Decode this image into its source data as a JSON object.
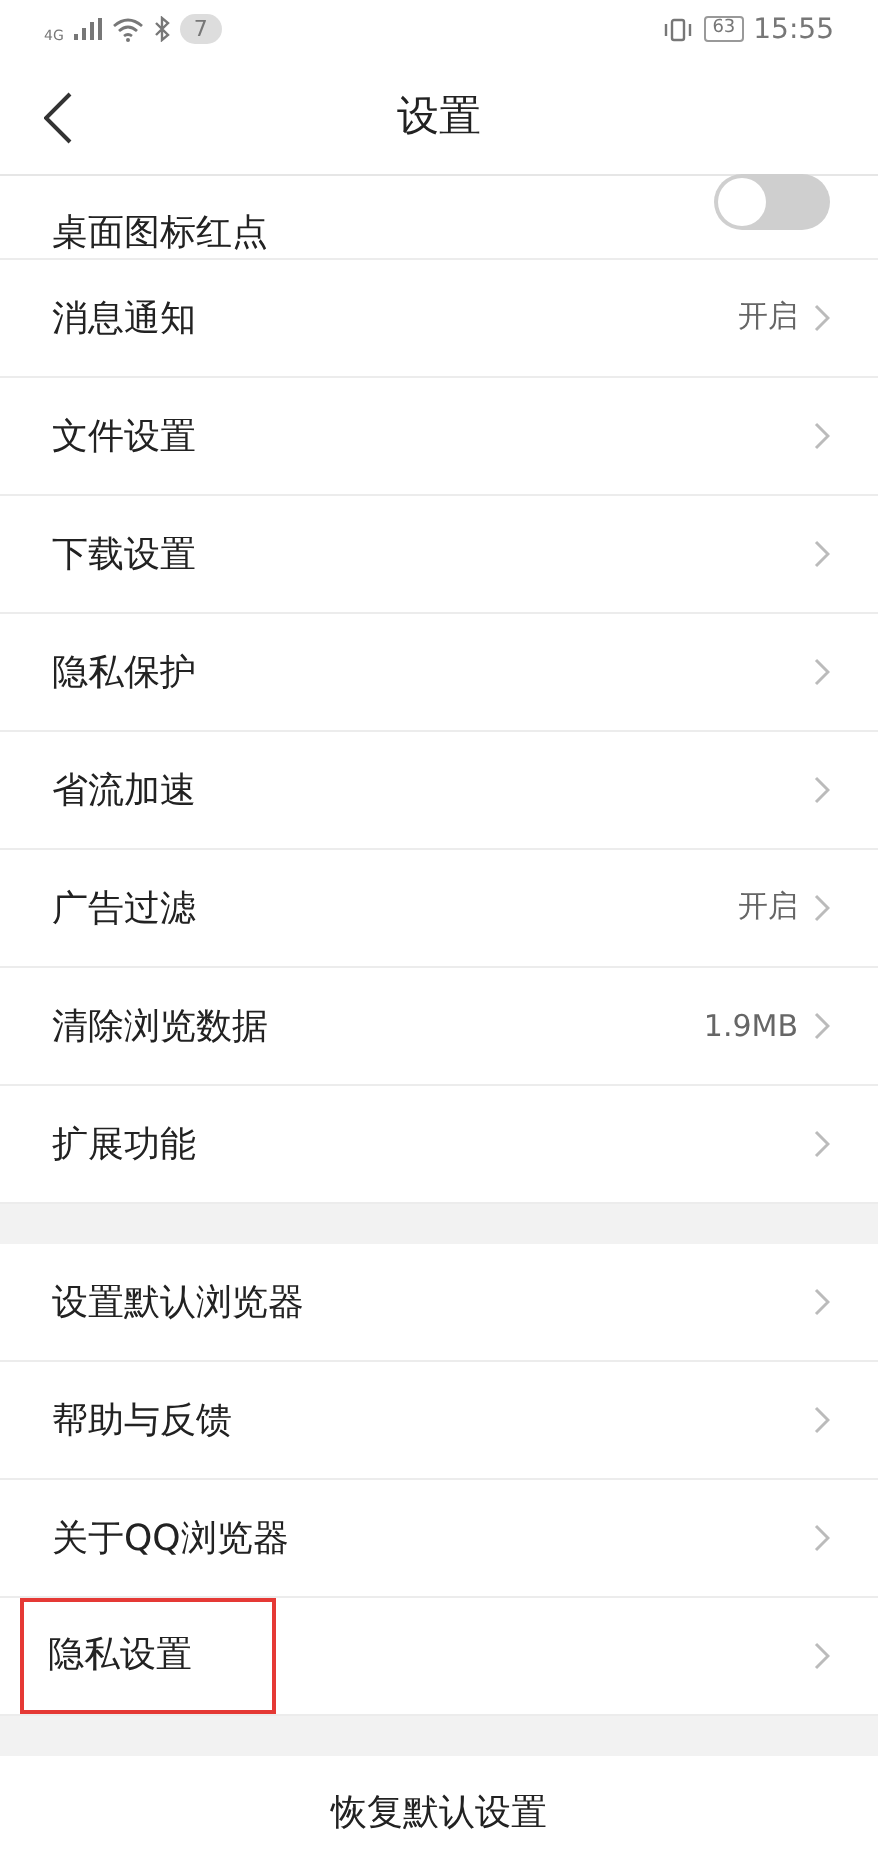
{
  "status_bar": {
    "network": "4G",
    "notification_count": "7",
    "battery": "63",
    "time": "15:55"
  },
  "header": {
    "title": "设置"
  },
  "groups": [
    {
      "items": [
        {
          "kind": "toggle",
          "label": "桌面图标红点",
          "on": false
        },
        {
          "kind": "link",
          "label": "消息通知",
          "value": "开启"
        },
        {
          "kind": "link",
          "label": "文件设置"
        },
        {
          "kind": "link",
          "label": "下载设置"
        },
        {
          "kind": "link",
          "label": "隐私保护"
        },
        {
          "kind": "link",
          "label": "省流加速"
        },
        {
          "kind": "link",
          "label": "广告过滤",
          "value": "开启"
        },
        {
          "kind": "link",
          "label": "清除浏览数据",
          "value": "1.9MB"
        },
        {
          "kind": "link",
          "label": "扩展功能"
        }
      ]
    },
    {
      "items": [
        {
          "kind": "link",
          "label": "设置默认浏览器"
        },
        {
          "kind": "link",
          "label": "帮助与反馈"
        },
        {
          "kind": "link",
          "label": "关于QQ浏览器"
        },
        {
          "kind": "link",
          "label": "隐私设置",
          "highlighted": true
        }
      ]
    }
  ],
  "reset_button": "恢复默认设置"
}
